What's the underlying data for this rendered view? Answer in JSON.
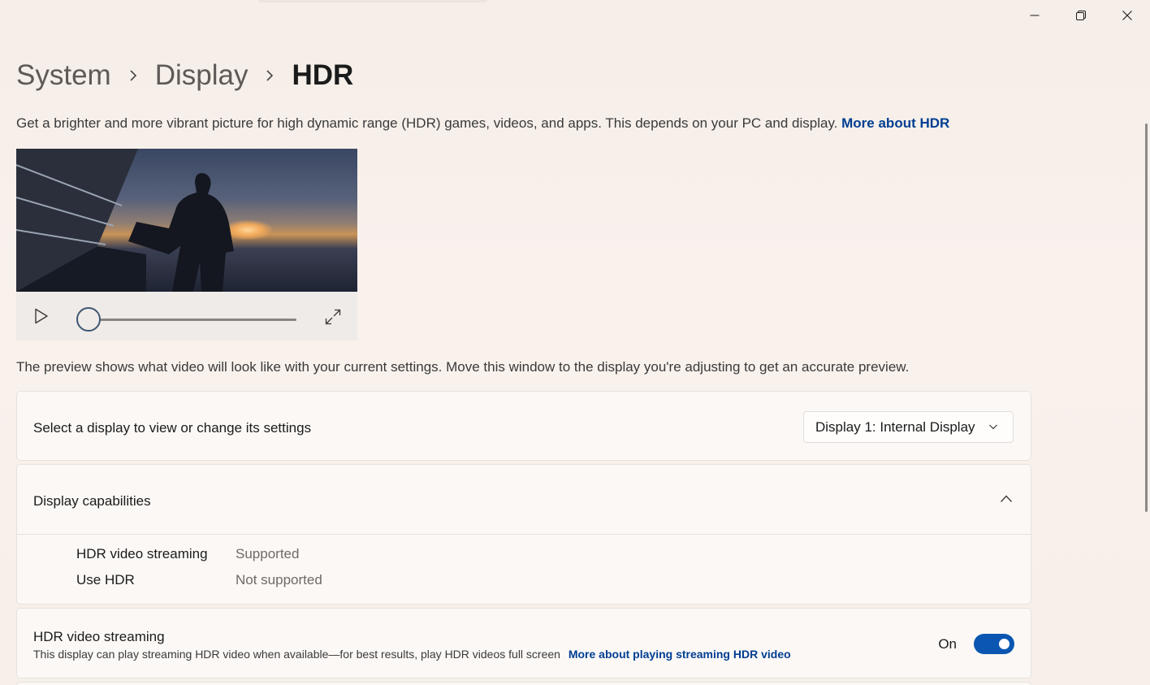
{
  "window": {
    "controls": {
      "minimize": "minimize-icon",
      "restore": "restore-icon",
      "close": "close-icon"
    }
  },
  "breadcrumb": {
    "items": [
      "System",
      "Display",
      "HDR"
    ]
  },
  "intro": {
    "text": "Get a brighter and more vibrant picture for high dynamic range (HDR) games, videos, and apps. This depends on your PC and display.",
    "link": "More about HDR"
  },
  "player": {
    "progress": 0
  },
  "preview_note": "The preview shows what video will look like with your current settings. Move this window to the display you're adjusting to get an accurate preview.",
  "display_select": {
    "label": "Select a display to view or change its settings",
    "value": "Display 1: Internal Display"
  },
  "capabilities": {
    "title": "Display capabilities",
    "rows": [
      {
        "name": "HDR video streaming",
        "value": "Supported"
      },
      {
        "name": "Use HDR",
        "value": "Not supported"
      }
    ]
  },
  "hdr_streaming": {
    "title": "HDR video streaming",
    "description": "This display can play streaming HDR video when available—for best results, play HDR videos full screen",
    "link": "More about playing streaming HDR video",
    "state_label": "On",
    "enabled": true
  },
  "colors": {
    "accent": "#0a56b0",
    "link": "#003e92"
  }
}
